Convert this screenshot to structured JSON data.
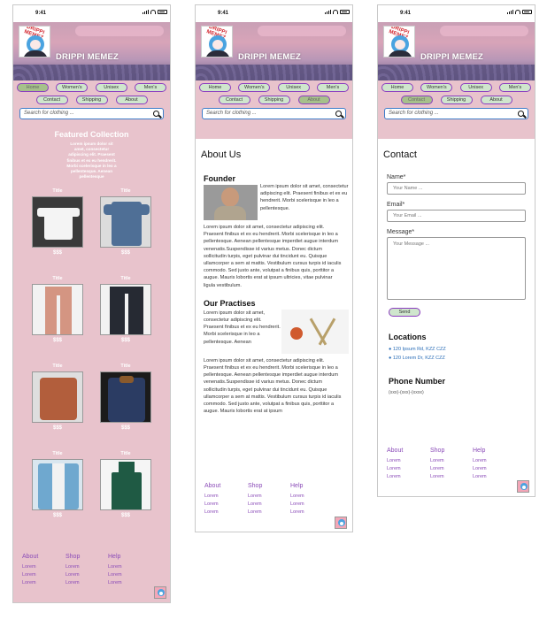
{
  "status": {
    "time": "9:41"
  },
  "header": {
    "brand": "DRIPPI MEMEZ",
    "logo_text": "DRIPPI MEMEZ"
  },
  "nav": {
    "row1": [
      "Home",
      "Women's",
      "Unisex",
      "Men's"
    ],
    "row2": [
      "Contact",
      "Shipping",
      "About"
    ]
  },
  "search": {
    "placeholder": "Search for clothing ..."
  },
  "home": {
    "featured_title": "Featured Collection",
    "featured_desc": "Lorem ipsum dolor sit amet, consectetur adipiscing elit. Praesent finibus et ex eu hendrerit. Morbi scelerisque in leo a pellentesque. Aenean pellentesque",
    "products": [
      {
        "title": "Title",
        "price": "$$$"
      },
      {
        "title": "Title",
        "price": "$$$"
      },
      {
        "title": "Title",
        "price": "$$$"
      },
      {
        "title": "Title",
        "price": "$$$"
      },
      {
        "title": "Title",
        "price": "$$$"
      },
      {
        "title": "Title",
        "price": "$$$"
      },
      {
        "title": "Title",
        "price": "$$$"
      },
      {
        "title": "Title",
        "price": "$$$"
      }
    ]
  },
  "about": {
    "title": "About Us",
    "founder_heading": "Founder",
    "founder_p1": "Lorem ipsum dolor sit amet, consectetur adipiscing elit. Praesent finibus et ex eu hendrerit. Morbi scelerisque in leo a pellentesque.",
    "founder_p2": "Lorem ipsum dolor sit amet, consectetur adipiscing elit. Praesent finibus et ex eu hendrerit. Morbi scelerisque in leo a pellentesque. Aenean pellentesque imperdiet augue interdum venenatis.Suspendisse id varius metus. Donec dictum sollicitudin turpis, eget pulvinar dui tincidunt eu. Quisque ullamcorper a sem at mattis. Vestibulum cursus turpis id iaculis commodo. Sed justo ante, volutpat a finibus quis, porttitor a augue. Mauris lobortis erat at ipsum ultricies, vitae pulvinar ligula vestibulum.",
    "practises_heading": "Our Practises",
    "practises_p1": "Lorem ipsum dolor sit amet, consectetur adipiscing elit. Praesent finibus et ex eu hendrerit. Morbi scelerisque in leo a pellentesque. Aenean",
    "practises_p2": "Lorem ipsum dolor sit amet, consectetur adipiscing elit. Praesent finibus et ex eu hendrerit. Morbi scelerisque in leo a pellentesque. Aenean pellentesque imperdiet augue interdum venenatis.Suspendisse id varius metus. Donec dictum sollicitudin turpis, eget pulvinar dui tincidunt eu. Quisque ullamcorper a sem at mattis. Vestibulum cursus turpis id iaculis commodo. Sed justo ante, volutpat a finibus quis, porttitor a augue. Mauris lobortis erat at ipsum"
  },
  "contact": {
    "title": "Contact",
    "name_label": "Name*",
    "name_placeholder": "Your Name ...",
    "email_label": "Email*",
    "email_placeholder": "Your Email ...",
    "message_label": "Message*",
    "message_placeholder": "Your Message ...",
    "send_label": "Send",
    "locations_heading": "Locations",
    "locations": [
      "120 Ipsum Rd, KZZ CZZ",
      "120 Lorem Dr, KZZ CZZ"
    ],
    "phone_heading": "Phone Number",
    "phone": "(xxx)-(xxx)-(xxxx)"
  },
  "footer": {
    "columns": [
      {
        "heading": "About",
        "links": [
          "Lorem",
          "Lorem",
          "Lorem"
        ]
      },
      {
        "heading": "Shop",
        "links": [
          "Lorem",
          "Lorem",
          "Lorem"
        ]
      },
      {
        "heading": "Help",
        "links": [
          "Lorem",
          "Lorem",
          "Lorem"
        ]
      }
    ]
  },
  "colors": {
    "page_pink": "#e8c3cc",
    "pill_border": "#8b3cc0",
    "pill_fill": "#cfe6cd",
    "search_border": "#3d7dca",
    "footer_text": "#8b4cb8",
    "location_text": "#2a6db7"
  },
  "icons": [
    "signal-icon",
    "wifi-icon",
    "battery-icon",
    "search-icon",
    "logo-icon"
  ]
}
